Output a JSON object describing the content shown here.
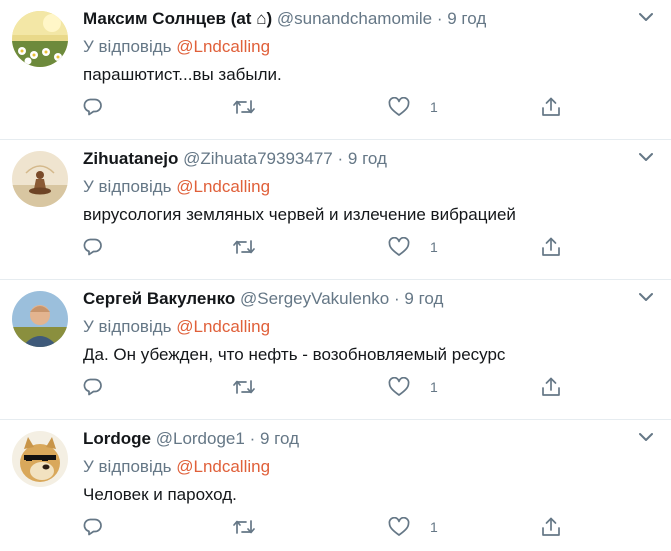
{
  "tweets": [
    {
      "name": "Максим Солнцев (at ⌂)",
      "handle": "@sunandchamomile",
      "time": "9 год",
      "reply_prefix": "У відповідь",
      "reply_to": "@Lndcalling",
      "text": "парашютист...вы забыли.",
      "likes": "1",
      "avatar": "daisy-field"
    },
    {
      "name": "Zihuatanejo",
      "handle": "@Zihuata79393477",
      "time": "9 год",
      "reply_prefix": "У відповідь",
      "reply_to": "@Lndcalling",
      "text": "вирусология земляных червей и излечение вибрацией",
      "likes": "1",
      "avatar": "meditating-figure"
    },
    {
      "name": "Сергей Вакуленко",
      "handle": "@SergeyVakulenko",
      "time": "9 год",
      "reply_prefix": "У відповідь",
      "reply_to": "@Lndcalling",
      "text": "Да. Он убежден, что нефть - возобновляемый ресурс",
      "likes": "1",
      "avatar": "man-portrait"
    },
    {
      "name": "Lordoge",
      "handle": "@Lordoge1",
      "time": "9 год",
      "reply_prefix": "У відповідь",
      "reply_to": "@Lndcalling",
      "text": "Человек и пароход.",
      "likes": "1",
      "avatar": "doge-sunglasses"
    }
  ],
  "separator": "·",
  "colors": {
    "mention": "#e0603a",
    "muted": "#657786",
    "text": "#14171a",
    "divider": "#e6ecf0"
  },
  "icons": {
    "reply": "reply-icon",
    "retweet": "retweet-icon",
    "like": "heart-icon",
    "share": "share-icon",
    "menu": "chevron-down-icon"
  }
}
